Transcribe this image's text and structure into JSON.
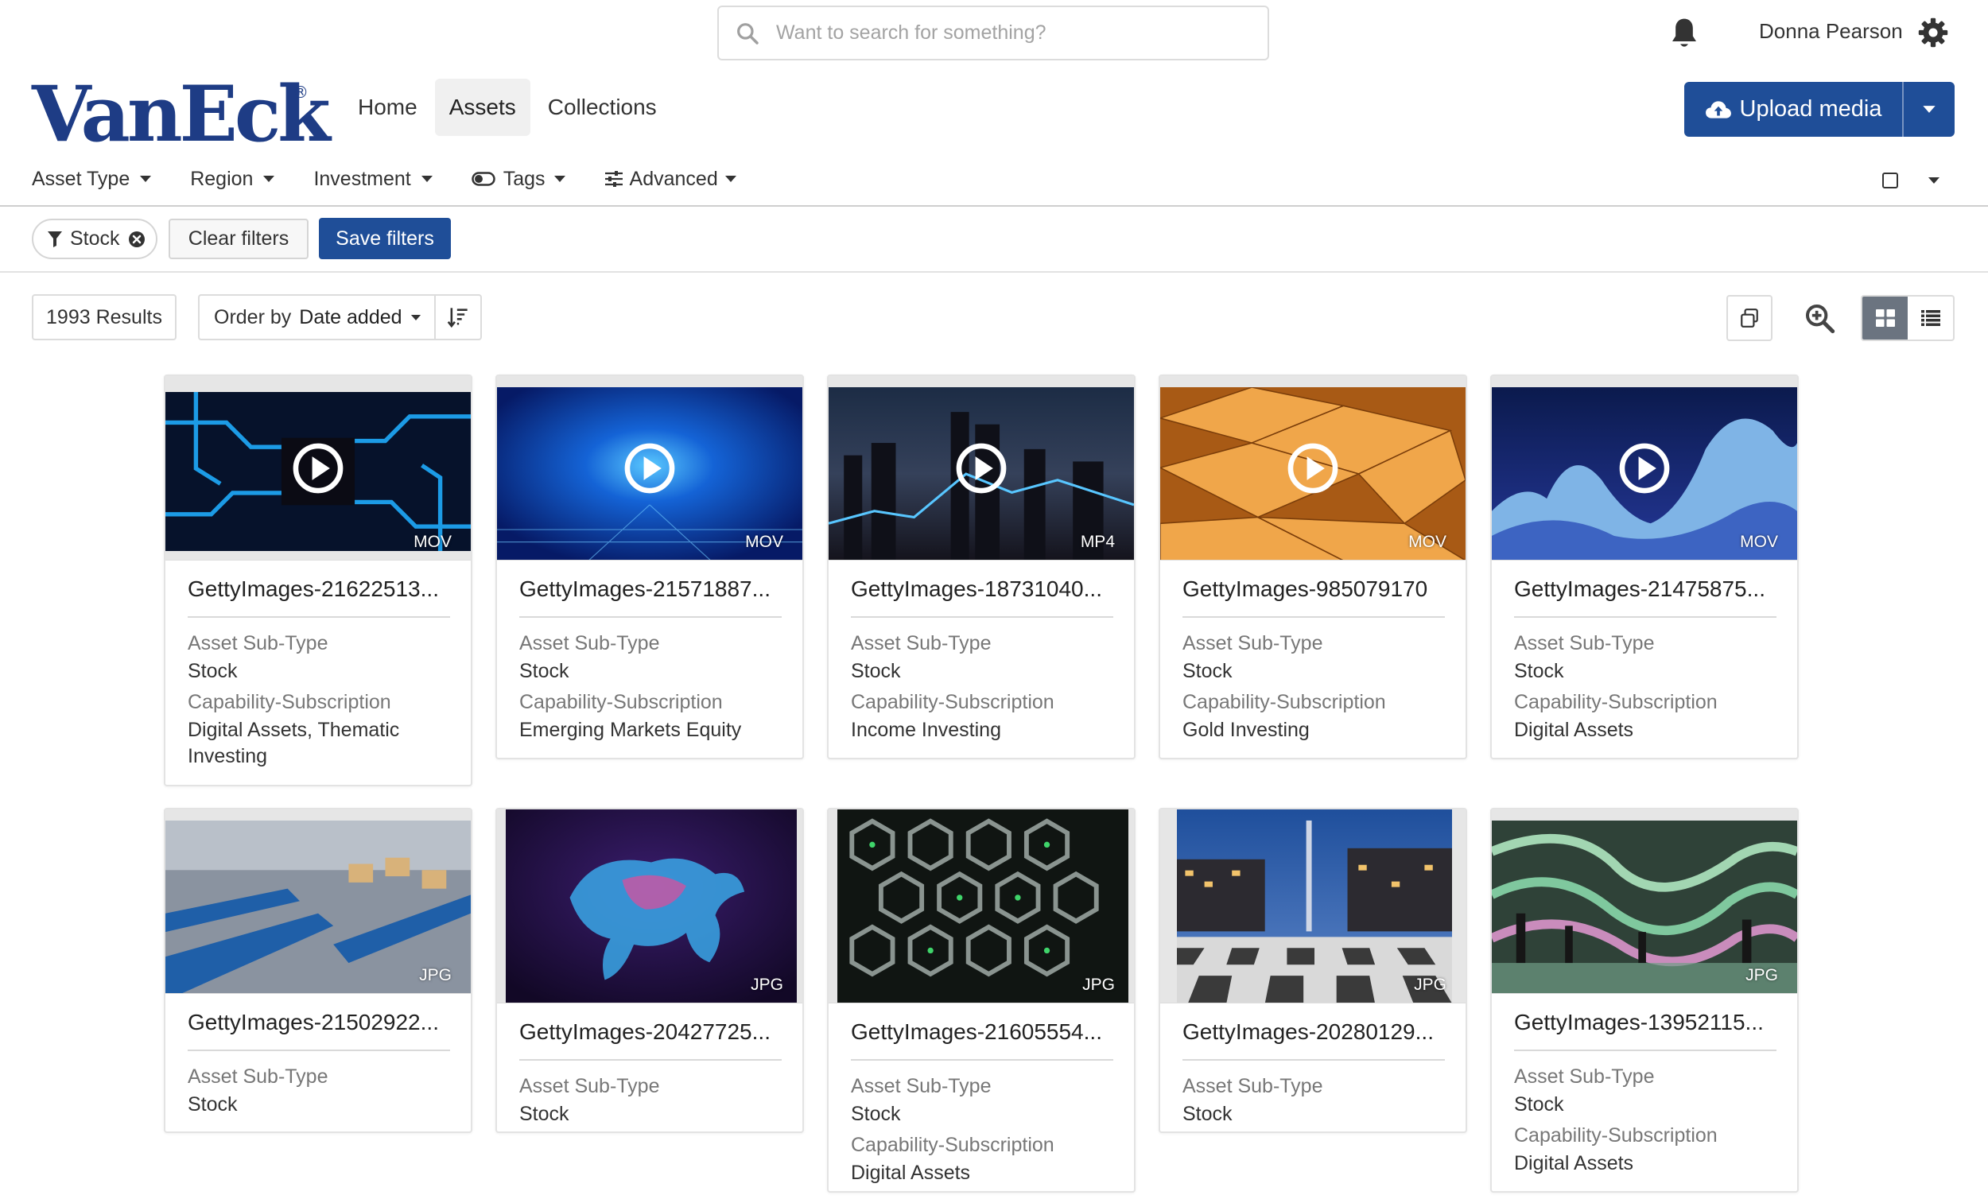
{
  "header": {
    "search_placeholder": "Want to search for something?",
    "user_name": "Donna Pearson",
    "logo_text": "VanEck",
    "logo_mark": "®"
  },
  "nav": {
    "home": "Home",
    "assets": "Assets",
    "collections": "Collections"
  },
  "upload": {
    "label": "Upload media"
  },
  "filters": {
    "asset_type": "Asset Type",
    "region": "Region",
    "investment": "Investment",
    "tags": "Tags",
    "advanced": "Advanced"
  },
  "active_filters": {
    "chip": "Stock",
    "clear": "Clear filters",
    "save": "Save filters"
  },
  "results": {
    "count": "1993 Results",
    "order_prefix": "Order by",
    "order_value": "Date added"
  },
  "colors": {
    "primary": "#1f4e98",
    "logo": "#1e3c85"
  },
  "cards": [
    {
      "title": "GettyImages-21622513...",
      "format": "MOV",
      "video": true,
      "l1": "Asset Sub-Type",
      "v1": "Stock",
      "l2": "Capability-Subscription",
      "v2": "Digital Assets, Thematic Investing"
    },
    {
      "title": "GettyImages-21571887...",
      "format": "MOV",
      "video": true,
      "l1": "Asset Sub-Type",
      "v1": "Stock",
      "l2": "Capability-Subscription",
      "v2": "Emerging Markets Equity"
    },
    {
      "title": "GettyImages-18731040...",
      "format": "MP4",
      "video": true,
      "l1": "Asset Sub-Type",
      "v1": "Stock",
      "l2": "Capability-Subscription",
      "v2": "Income Investing"
    },
    {
      "title": "GettyImages-985079170",
      "format": "MOV",
      "video": true,
      "l1": "Asset Sub-Type",
      "v1": "Stock",
      "l2": "Capability-Subscription",
      "v2": "Gold Investing"
    },
    {
      "title": "GettyImages-21475875...",
      "format": "MOV",
      "video": true,
      "l1": "Asset Sub-Type",
      "v1": "Stock",
      "l2": "Capability-Subscription",
      "v2": "Digital Assets"
    },
    {
      "title": "GettyImages-21502922...",
      "format": "JPG",
      "video": false,
      "l1": "Asset Sub-Type",
      "v1": "Stock"
    },
    {
      "title": "GettyImages-20427725...",
      "format": "JPG",
      "video": false,
      "l1": "Asset Sub-Type",
      "v1": "Stock"
    },
    {
      "title": "GettyImages-21605554...",
      "format": "JPG",
      "video": false,
      "l1": "Asset Sub-Type",
      "v1": "Stock",
      "l2": "Capability-Subscription",
      "v2": "Digital Assets"
    },
    {
      "title": "GettyImages-20280129...",
      "format": "JPG",
      "video": false,
      "l1": "Asset Sub-Type",
      "v1": "Stock"
    },
    {
      "title": "GettyImages-13952115...",
      "format": "JPG",
      "video": false,
      "l1": "Asset Sub-Type",
      "v1": "Stock",
      "l2": "Capability-Subscription",
      "v2": "Digital Assets"
    }
  ]
}
